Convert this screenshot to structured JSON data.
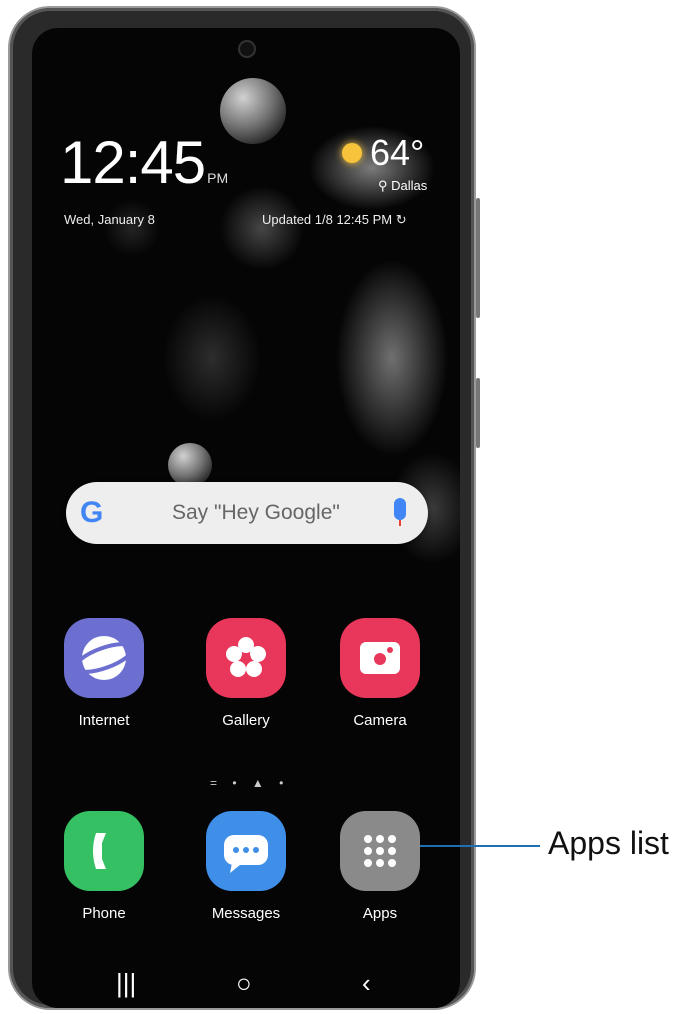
{
  "lockscreen": {
    "time": "12:45",
    "ampm": "PM",
    "date": "Wed, January 8",
    "temperature": "64°",
    "location": "Dallas",
    "updated": "Updated 1/8 12:45 PM ↻"
  },
  "search": {
    "placeholder": "Say \"Hey Google\"",
    "google_glyph": "G"
  },
  "apps_row1": [
    {
      "label": "Internet",
      "color": "#6c6fcf",
      "icon": "internet-icon"
    },
    {
      "label": "Gallery",
      "color": "#e8375a",
      "icon": "gallery-icon"
    },
    {
      "label": "Camera",
      "color": "#e8375a",
      "icon": "camera-icon"
    }
  ],
  "page_indicator": "= • ▲ •",
  "apps_dock": [
    {
      "label": "Phone",
      "color": "#34c063",
      "icon": "phone-icon"
    },
    {
      "label": "Messages",
      "color": "#3f8ee8",
      "icon": "messages-icon"
    },
    {
      "label": "Apps",
      "color": "#8a8a8a",
      "icon": "apps-grid-icon"
    }
  ],
  "navbar": {
    "recents": "|||",
    "home": "○",
    "back": "‹"
  },
  "callout": {
    "text": "Apps list",
    "line_color": "#1f6fb5"
  }
}
